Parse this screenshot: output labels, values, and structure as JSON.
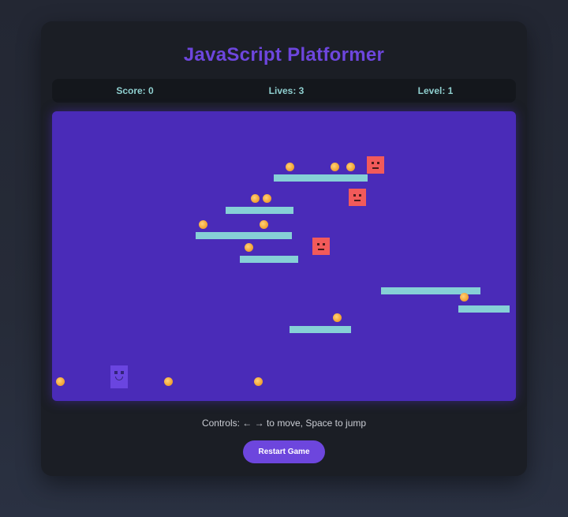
{
  "title": "JavaScript Platformer",
  "stats": {
    "score": "Score: 0",
    "lives": "Lives: 3",
    "level": "Level: 1"
  },
  "game": {
    "background_color": "#4a2bb8",
    "platform_color": "#86d0d6",
    "enemy_color": "#f25a5a",
    "player_color": "#6a45e0",
    "coin_color": "#f4a93a"
  },
  "controls_text": "Controls: ← → to move, Space to jump",
  "restart_label": "Restart Game",
  "colors": {
    "accent": "#6d46dd",
    "stat_text": "#8fcfcf",
    "panel": "#1b1e25"
  }
}
